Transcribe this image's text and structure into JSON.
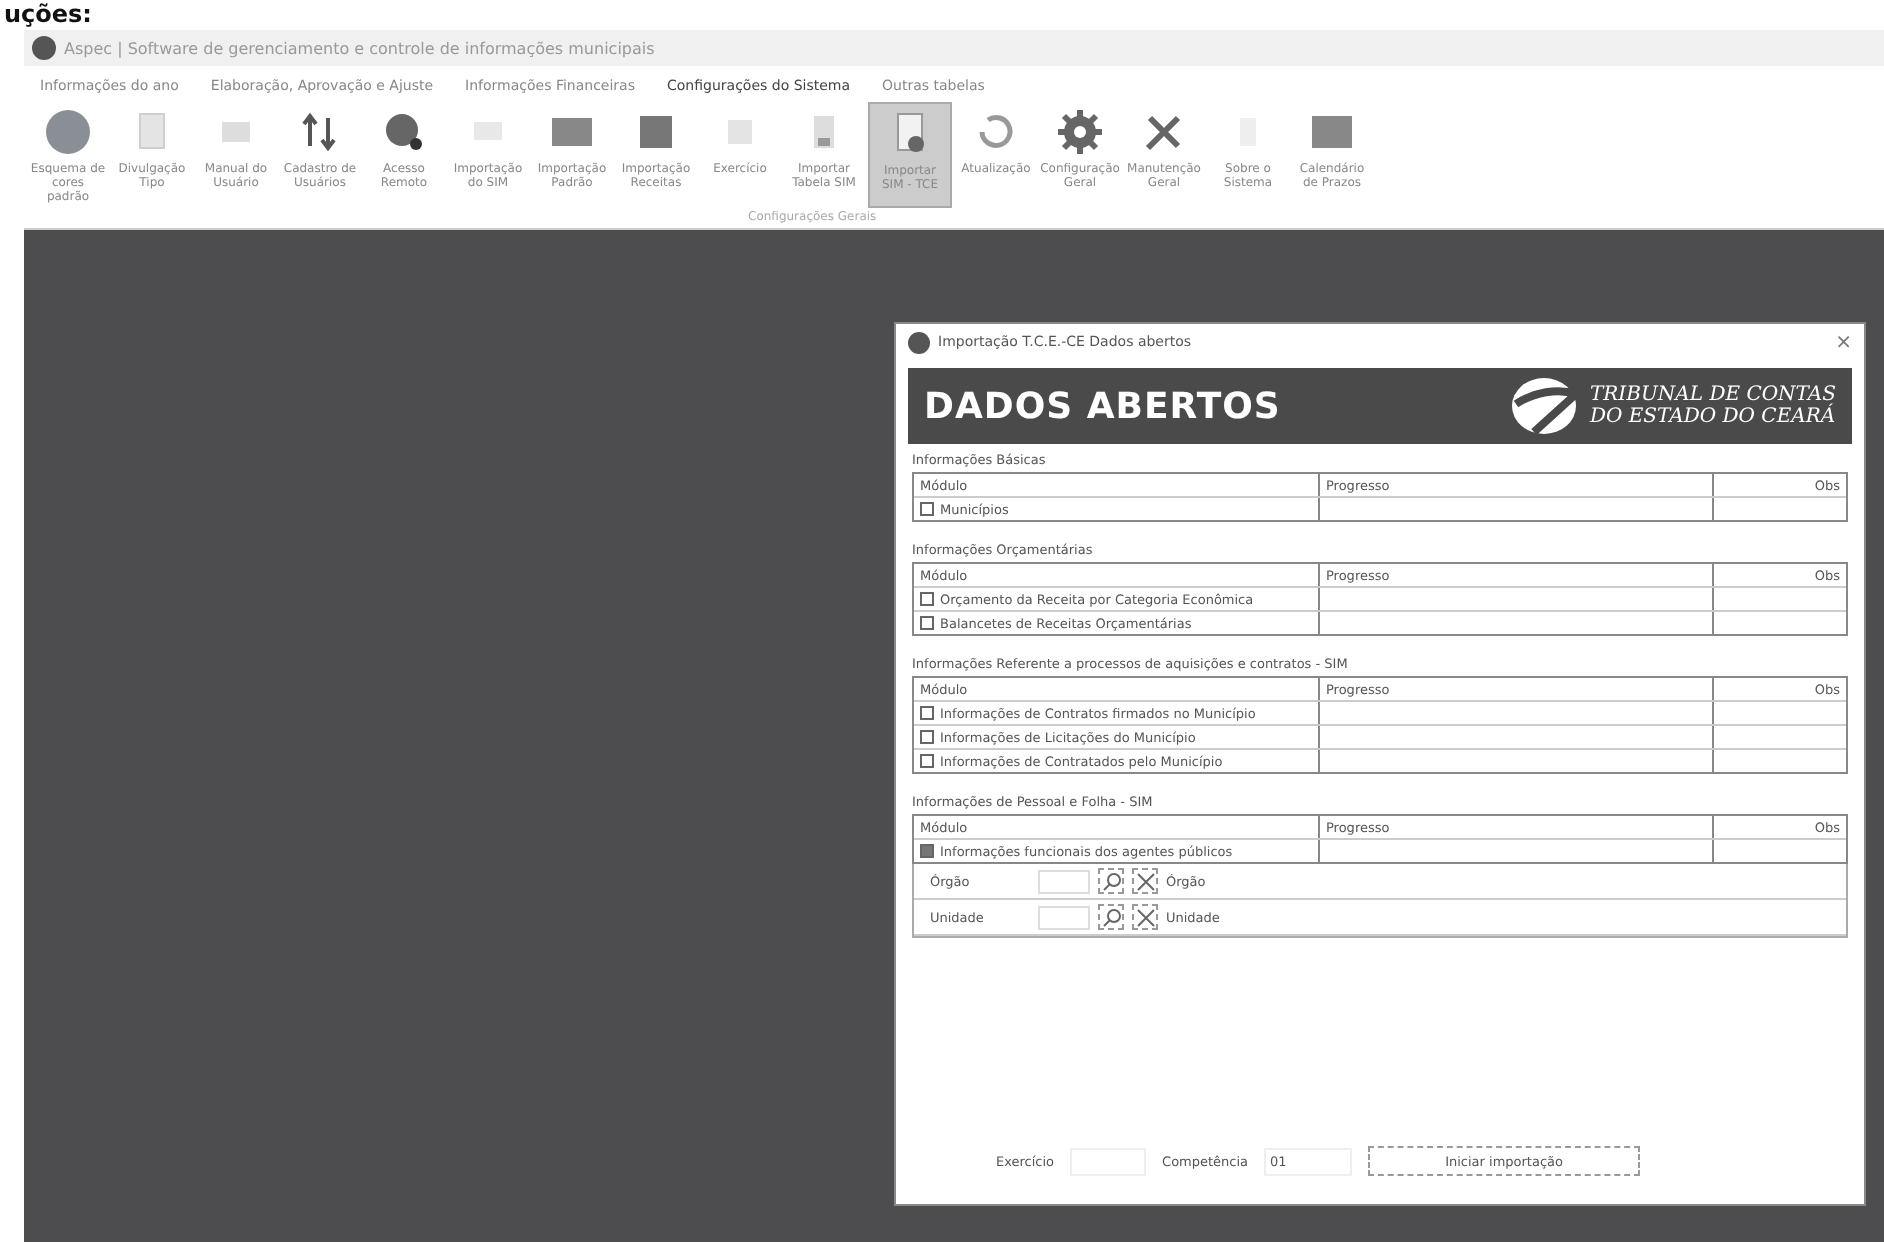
{
  "caption": "uções:",
  "window": {
    "title": "Aspec | Software de gerenciamento e controle de informações municipais"
  },
  "ribbon_tabs": [
    {
      "label": "Informações do ano",
      "selected": false
    },
    {
      "label": "Elaboração, Aprovação e Ajuste",
      "selected": false
    },
    {
      "label": "Informações Financeiras",
      "selected": false
    },
    {
      "label": "Configurações do Sistema",
      "selected": true
    },
    {
      "label": "Outras tabelas",
      "selected": false
    }
  ],
  "ribbon_items": [
    {
      "label": "Esquema de cores padrão",
      "selected": false
    },
    {
      "label": "Divulgação Tipo",
      "selected": false
    },
    {
      "label": "Manual do Usuário",
      "selected": false
    },
    {
      "label": "Cadastro de Usuários",
      "selected": false
    },
    {
      "label": "Acesso Remoto",
      "selected": false
    },
    {
      "label": "Importação do SIM",
      "selected": false
    },
    {
      "label": "Importação Padrão",
      "selected": false
    },
    {
      "label": "Importação Receitas",
      "selected": false
    },
    {
      "label": "Exercício",
      "selected": false
    },
    {
      "label": "Importar Tabela SIM",
      "selected": false
    },
    {
      "label": "Importar SIM - TCE",
      "selected": true
    },
    {
      "label": "Atualização",
      "selected": false
    },
    {
      "label": "Configuração Geral",
      "selected": false
    },
    {
      "label": "Manutenção Geral",
      "selected": false
    },
    {
      "label": "Sobre o Sistema",
      "selected": false
    },
    {
      "label": "Calendário de Prazos",
      "selected": false
    }
  ],
  "ribbon_group": "Configurações Gerais",
  "dialog": {
    "title": "Importação T.C.E.-CE Dados abertos",
    "close": "×",
    "banner": "DADOS ABERTOS",
    "logo_line_1": "TRIBUNAL DE CONTAS",
    "logo_line_2": "DO ESTADO DO CEARÁ",
    "sections": [
      {
        "title": "Informações Básicas",
        "columns": [
          "Módulo",
          "Progresso",
          "Obs"
        ],
        "rows": [
          {
            "label": "Municípios",
            "checked": false
          }
        ]
      },
      {
        "title": "Informações Orçamentárias",
        "columns": [
          "Módulo",
          "Progresso",
          "Obs"
        ],
        "rows": [
          {
            "label": "Orçamento da Receita por Categoria Econômica",
            "checked": false
          },
          {
            "label": "Balancetes de Receitas Orçamentárias",
            "checked": false
          }
        ]
      },
      {
        "title": "Informações Referente a processos de aquisições e contratos - SIM",
        "columns": [
          "Módulo",
          "Progresso",
          "Obs"
        ],
        "rows": [
          {
            "label": "Informações de Contratos firmados no Município",
            "checked": false
          },
          {
            "label": "Informações de Licitações do Município",
            "checked": false
          },
          {
            "label": "Informações de Contratados pelo Município",
            "checked": false
          }
        ]
      },
      {
        "title": "Informações de Pessoal e Folha - SIM",
        "columns": [
          "Módulo",
          "Progresso",
          "Obs"
        ],
        "rows": [
          {
            "label": "Informações funcionais dos agentes públicos",
            "checked": true
          }
        ],
        "filters": [
          {
            "label": "Órgão",
            "value_label": "Órgão"
          },
          {
            "label": "Unidade",
            "value_label": "Unidade"
          }
        ]
      }
    ],
    "exercise_label": "Exercício",
    "competence_label": "Competência",
    "competence_value": "01",
    "start_button": "Iniciar importação"
  }
}
